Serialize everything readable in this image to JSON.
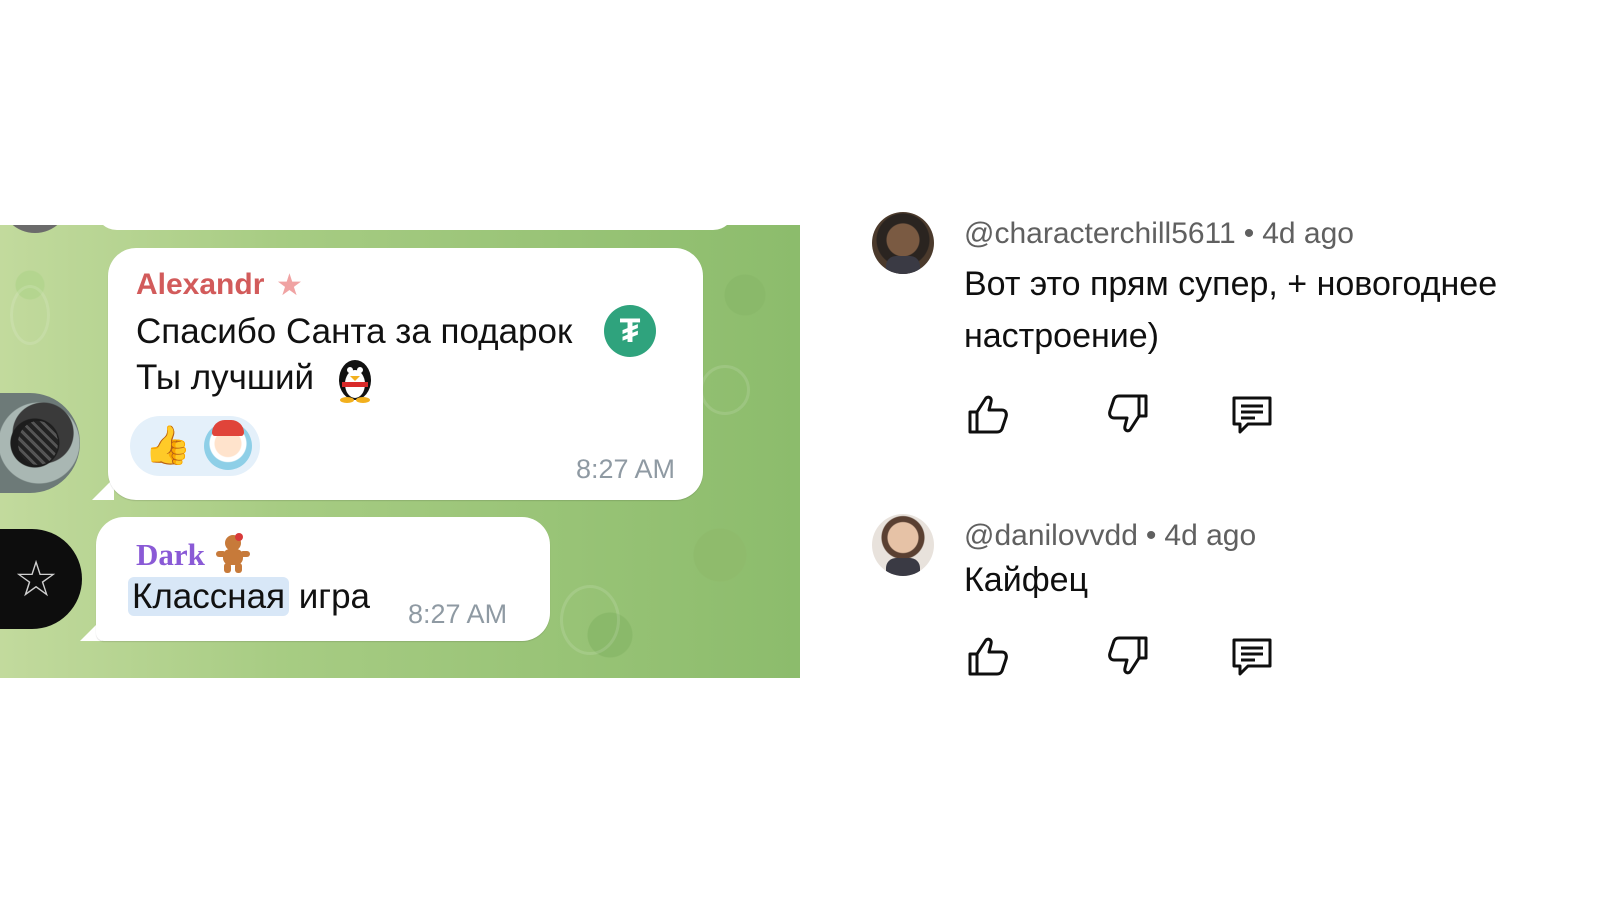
{
  "telegram": {
    "messages": [
      {
        "sender": "Alexandr",
        "lines": [
          "Спасибо Санта за подарок",
          "Ты лучший"
        ],
        "reactions": [
          "thumbs-up",
          "santa"
        ],
        "time": "8:27 AM"
      },
      {
        "sender": "Dark",
        "highlighted": "Классная",
        "rest": " игра",
        "time": "8:27 AM"
      }
    ],
    "colors": {
      "background": "#9cc47a",
      "alexandr": "#d25b5b",
      "dark": "#8a5ad6"
    }
  },
  "comments": [
    {
      "author": "@characterchill5611",
      "age": "4d ago",
      "text": "Вот это прям супер, + новогоднее настроение)"
    },
    {
      "author": "@danilovvdd",
      "age": "4d ago",
      "text": "Кайфец"
    }
  ],
  "icons": [
    "thumbs-up-icon",
    "thumbs-down-icon",
    "reply-icon",
    "star-icon",
    "tether-icon",
    "penguin-icon",
    "gingerbread-icon"
  ]
}
